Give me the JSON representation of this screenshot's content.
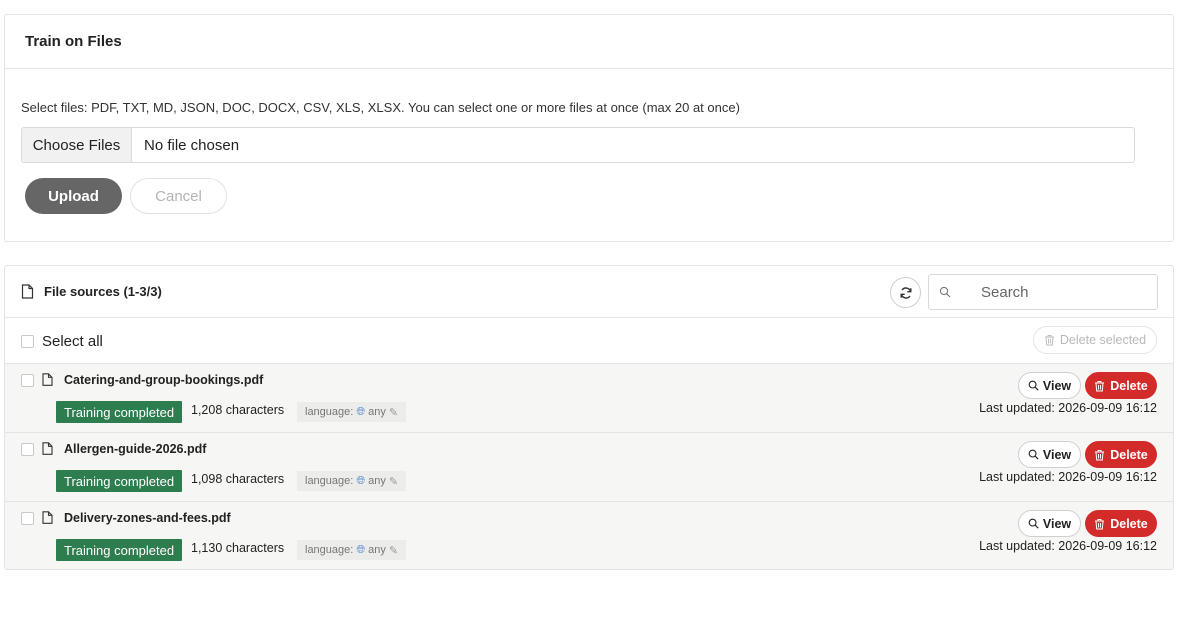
{
  "upload": {
    "title": "Train on Files",
    "hint": "Select files: PDF, TXT, MD, JSON, DOC, DOCX, CSV, XLS, XLSX. You can select one or more files at once (max 20 at once)",
    "choose_label": "Choose Files",
    "no_file": "No file chosen",
    "upload_label": "Upload",
    "cancel_label": "Cancel"
  },
  "sources": {
    "title": "File sources (1-3/3)",
    "search_placeholder": "Search",
    "select_all_label": "Select all",
    "delete_selected_label": "Delete selected",
    "view_label": "View",
    "delete_label": "Delete",
    "files": [
      {
        "name": "Catering-and-group-bookings.pdf",
        "status": "Training completed",
        "characters": "1,208 characters",
        "language_label": "language:",
        "language_value": "any",
        "updated": "Last updated: 2026-09-09 16:12"
      },
      {
        "name": "Allergen-guide-2026.pdf",
        "status": "Training completed",
        "characters": "1,098 characters",
        "language_label": "language:",
        "language_value": "any",
        "updated": "Last updated: 2026-09-09 16:12"
      },
      {
        "name": "Delivery-zones-and-fees.pdf",
        "status": "Training completed",
        "characters": "1,130 characters",
        "language_label": "language:",
        "language_value": "any",
        "updated": "Last updated: 2026-09-09 16:12"
      }
    ]
  },
  "colors": {
    "status_green": "#2e7d4f",
    "delete_red": "#d32a2a",
    "upload_gray": "#666666"
  },
  "icons": {
    "document": "document-icon",
    "refresh": "refresh-icon",
    "search": "search-icon",
    "trash": "trash-icon",
    "magnifier": "magnifier-icon",
    "globe": "globe-icon",
    "pencil": "pencil-icon"
  }
}
